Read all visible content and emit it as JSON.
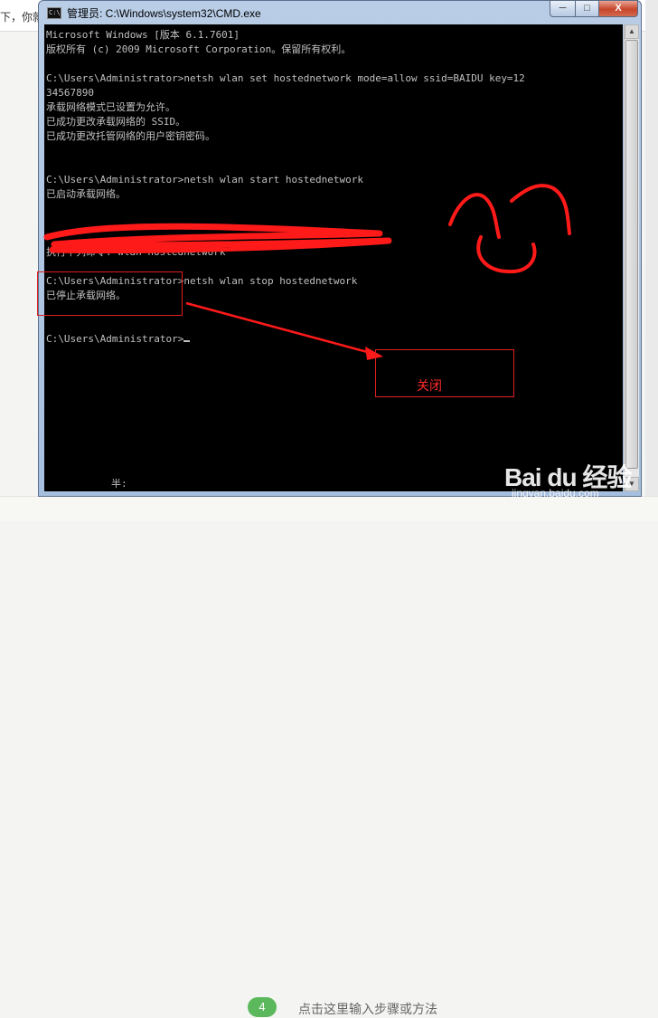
{
  "background_page": {
    "cut_text": "下，你就",
    "step_number": "4",
    "step_placeholder": "点击这里输入步骤或方法"
  },
  "window": {
    "title": "管理员: C:\\Windows\\system32\\CMD.exe",
    "buttons": {
      "minimize": "─",
      "maximize": "□",
      "close": "X"
    }
  },
  "console": {
    "lines": [
      "Microsoft Windows [版本 6.1.7601]",
      "版权所有 (c) 2009 Microsoft Corporation。保留所有权利。",
      "",
      "C:\\Users\\Administrator>netsh wlan set hostednetwork mode=allow ssid=BAIDU key=12",
      "34567890",
      "承载网络模式已设置为允许。",
      "已成功更改承载网络的 SSID。",
      "已成功更改托管网络的用户密钥密码。",
      "",
      "",
      "C:\\Users\\Administrator>netsh wlan start hostednetwork",
      "已启动承载网络。",
      "",
      "",
      "",
      "执行下列命令: wlan hostednetwork",
      "",
      "C:\\Users\\Administrator>netsh wlan stop hostednetwork",
      "已停止承载网络。",
      "",
      "",
      "C:\\Users\\Administrator>"
    ],
    "ime_status": "半:"
  },
  "annotations": {
    "close_label": "关闭",
    "ink_color": "#ff1a1a"
  },
  "watermark": {
    "logo": "Bai du 经验",
    "url": "jingyan.baidu.com"
  }
}
